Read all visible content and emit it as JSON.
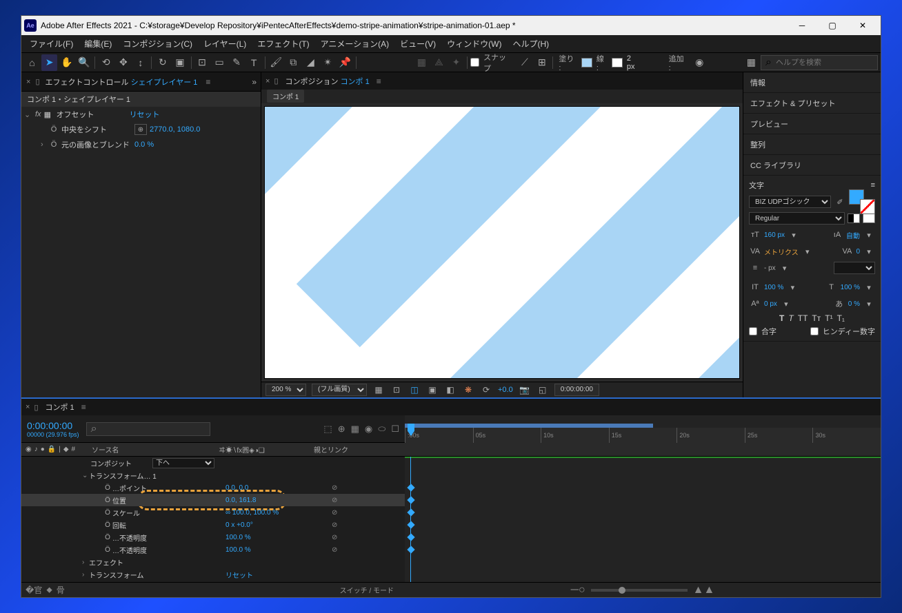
{
  "title": "Adobe After Effects 2021 - C:¥storage¥Develop Repository¥iPentecAfterEffects¥demo-stripe-animation¥stripe-animation-01.aep *",
  "app_icon": "Ae",
  "menus": [
    "ファイル(F)",
    "編集(E)",
    "コンポジション(C)",
    "レイヤー(L)",
    "エフェクト(T)",
    "アニメーション(A)",
    "ビュー(V)",
    "ウィンドウ(W)",
    "ヘルプ(H)"
  ],
  "toolbar": {
    "snap": "スナップ",
    "fill": "塗り :",
    "stroke": "線 :",
    "stroke_px": "2 px",
    "add": "追加 :",
    "search_placeholder": "ヘルプを検索"
  },
  "effects_panel": {
    "tab": "エフェクトコントロール",
    "layer_link": "シェイプレイヤー 1",
    "subhead": "コンポ 1・シェイプレイヤー 1",
    "effect_name": "オフセット",
    "reset": "リセット",
    "prop1": "中央をシフト",
    "prop1_val": "2770.0, 1080.0",
    "prop2": "元の画像とブレンド",
    "prop2_val": "0.0 %"
  },
  "comp_panel": {
    "tab": "コンポジション",
    "comp_link": "コンポ 1",
    "crumb": "コンポ 1"
  },
  "viewer": {
    "zoom": "200 %",
    "res": "(フル画質)",
    "exposure": "+0.0",
    "time": "0:00:00:00"
  },
  "right_panels": [
    "情報",
    "エフェクト & プリセット",
    "プレビュー",
    "整列",
    "CC ライブラリ"
  ],
  "char": {
    "title": "文字",
    "font": "BIZ UDPゴシック",
    "style": "Regular",
    "size": "160 px",
    "leading": "自動",
    "kerning": "メトリクス",
    "tracking": "0",
    "stroke": "- px",
    "vscale": "100 %",
    "hscale": "100 %",
    "baseline": "0 px",
    "tsume": "0 %",
    "ligature": "合字",
    "hindi": "ヒンディー数字"
  },
  "timeline": {
    "tab": "コンポ 1",
    "time": "0:00:00:00",
    "fps": "00000 (29.976 fps)",
    "col_source": "ソース名",
    "col_switches": "ヰ☀∖fx圓◈◑❏",
    "col_parent": "親とリンク",
    "ruler": [
      ":00s",
      "05s",
      "10s",
      "15s",
      "20s",
      "25s",
      "30s"
    ],
    "rows": [
      {
        "indent": 100,
        "name": "コンポジット",
        "val": "下へ",
        "dropdown": true
      },
      {
        "indent": 88,
        "chev": "⌄",
        "name": "トランスフォーム… 1"
      },
      {
        "indent": 118,
        "sw": "Ö",
        "name": "…ポイント",
        "val": "0.0, 0.0",
        "link": true,
        "kf": true
      },
      {
        "indent": 118,
        "sw": "Ö",
        "name": "位置",
        "val": "0.0, 161.8",
        "link": true,
        "sel": true,
        "kf": true
      },
      {
        "indent": 118,
        "sw": "Ö",
        "name": "スケール",
        "val": "∞ 100.0, 100.0 %",
        "link": true,
        "kf": true
      },
      {
        "indent": 118,
        "sw": "Ö",
        "name": "回転",
        "val": "0 x +0.0°",
        "link": true,
        "kf": true
      },
      {
        "indent": 118,
        "sw": "Ö",
        "name": "…不透明度",
        "val": "100.0 %",
        "link": true,
        "kf": true
      },
      {
        "indent": 118,
        "sw": "Ö",
        "name": "…不透明度",
        "val": "100.0 %",
        "link": true,
        "kf": true
      },
      {
        "indent": 88,
        "chev": "›",
        "name": "エフェクト"
      },
      {
        "indent": 88,
        "chev": "›",
        "name": "トランスフォーム",
        "reset": "リセット"
      }
    ],
    "foot_switch": "スイッチ / モード"
  }
}
